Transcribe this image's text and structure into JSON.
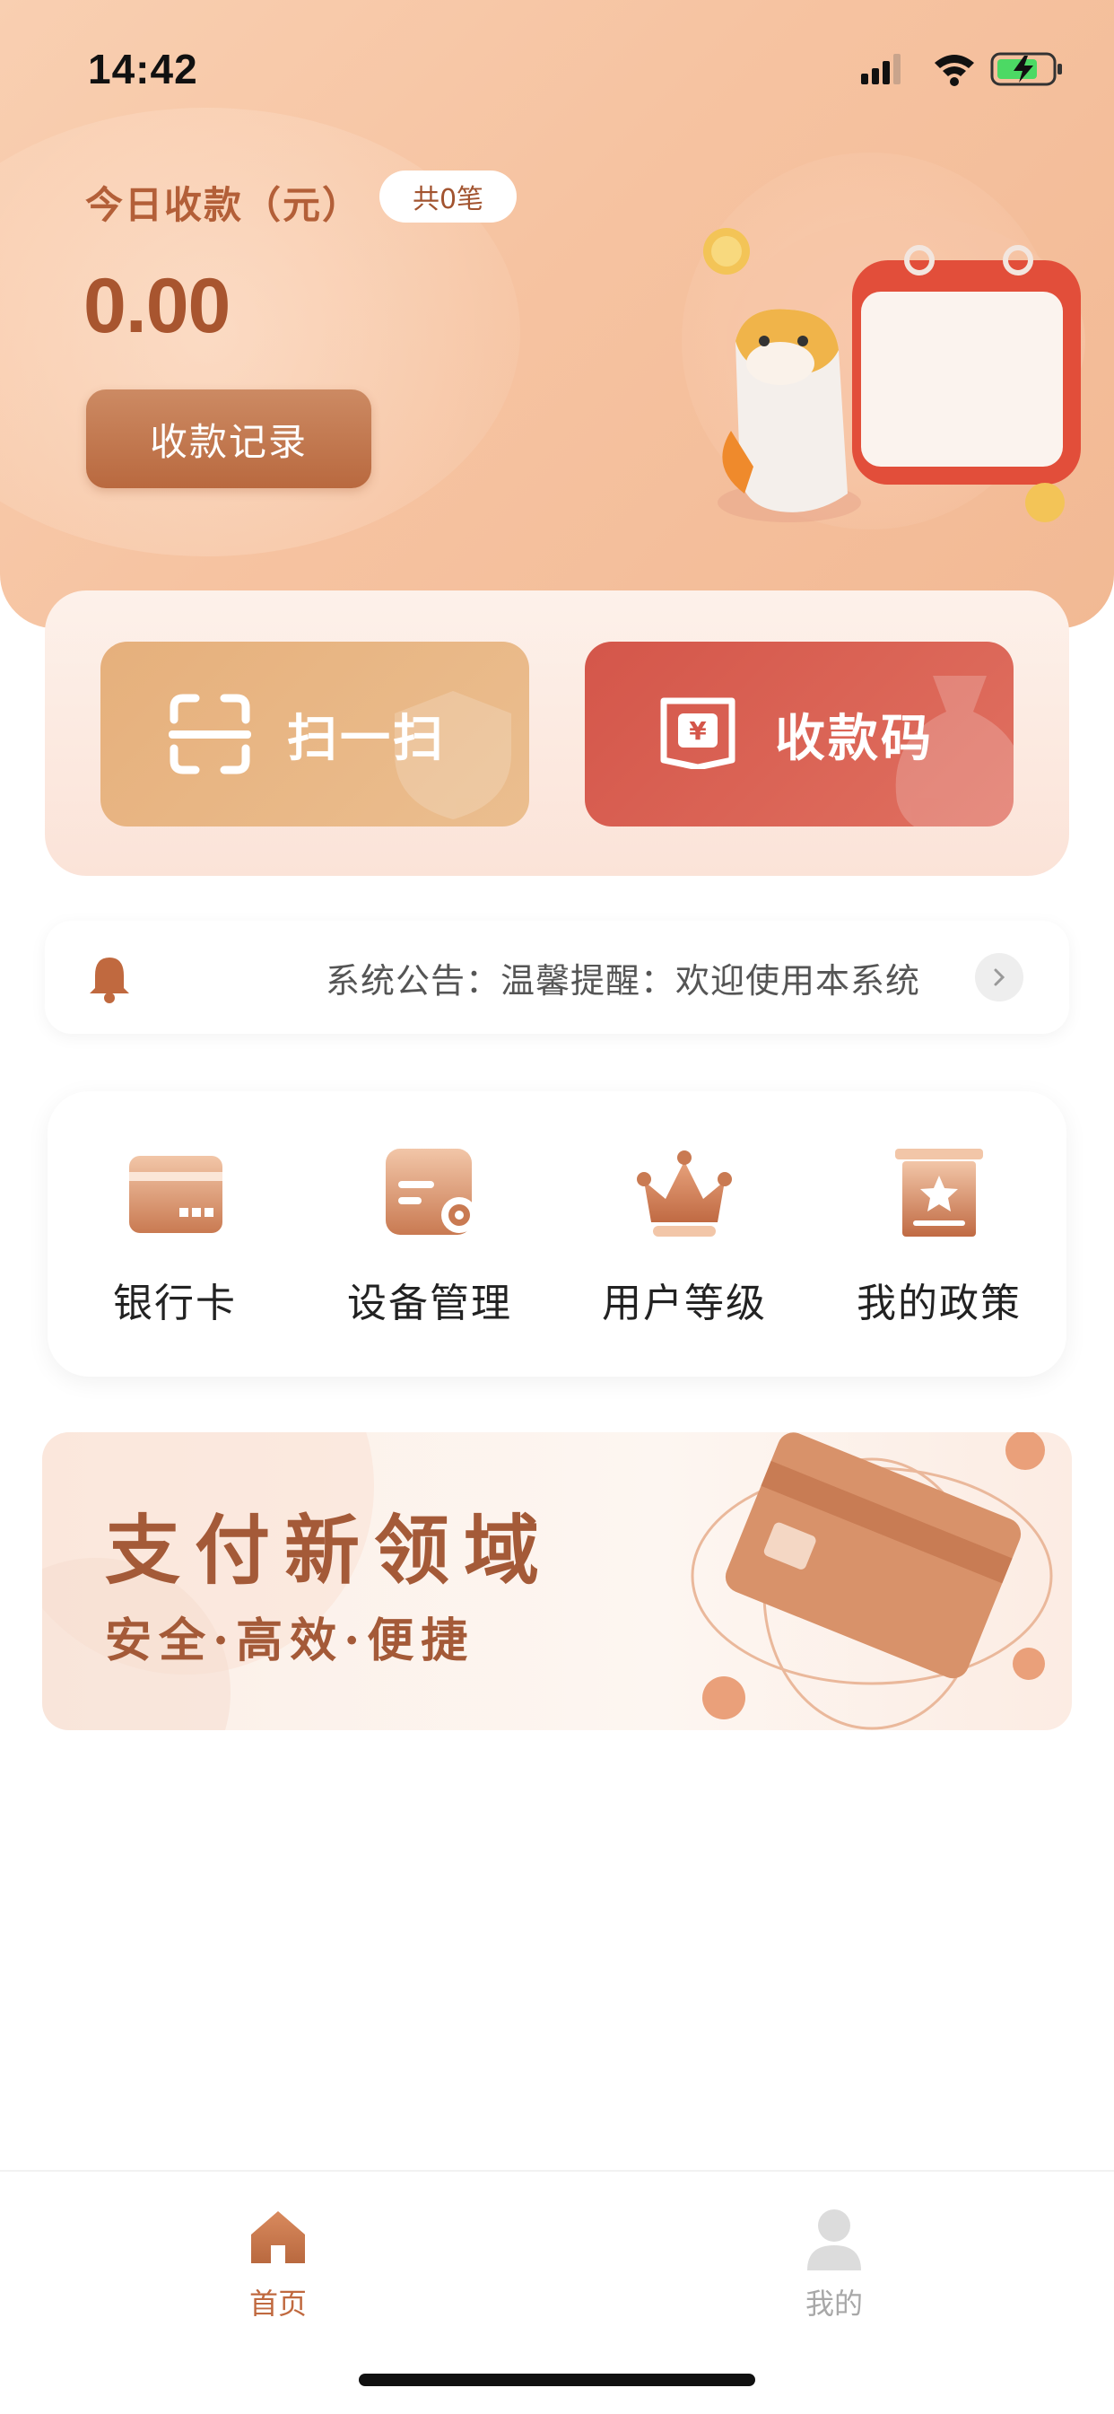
{
  "status_bar": {
    "time": "14:42",
    "icons": [
      "signal-icon",
      "wifi-icon",
      "battery-charging-icon"
    ]
  },
  "header": {
    "today_label": "今日收款（元）",
    "count_badge": "共0笔",
    "amount": "0.00",
    "record_button": "收款记录"
  },
  "actions": {
    "scan_label": "扫一扫",
    "qr_label": "收款码"
  },
  "notice": {
    "text": "系统公告：温馨提醒：欢迎使用本系统"
  },
  "menu": {
    "items": [
      {
        "label": "银行卡",
        "icon": "bank-card-icon"
      },
      {
        "label": "设备管理",
        "icon": "device-settings-icon"
      },
      {
        "label": "用户等级",
        "icon": "crown-icon"
      },
      {
        "label": "我的政策",
        "icon": "policy-badge-icon"
      }
    ]
  },
  "banner": {
    "title": "支付新领域",
    "subtitle": "安全·高效·便捷"
  },
  "tabbar": {
    "tabs": [
      {
        "label": "首页",
        "icon": "home-icon",
        "active": true
      },
      {
        "label": "我的",
        "icon": "user-icon",
        "active": false
      }
    ]
  },
  "colors": {
    "accent": "#b35f38",
    "scan_button": "#e6b07c",
    "qr_button": "#d4564a",
    "tab_active": "#c0693f",
    "tab_inactive": "#a8a8a8"
  }
}
